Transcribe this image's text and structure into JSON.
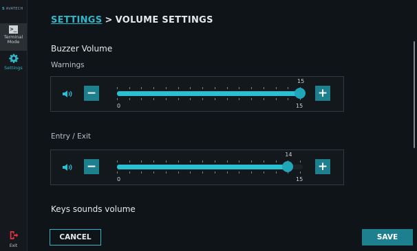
{
  "sidebar": {
    "brand": "AVATECH",
    "items": [
      {
        "label": "Terminal Mode",
        "icon": "terminal-icon"
      },
      {
        "label": "Settings",
        "icon": "gear-icon"
      }
    ],
    "exit_label": "Exit",
    "accent": "#2fb7c9"
  },
  "header": {
    "breadcrumb_link": "SETTINGS",
    "separator": ">",
    "title": "VOLUME SETTINGS"
  },
  "buzzer": {
    "title": "Buzzer Volume",
    "sliders": [
      {
        "label": "Warnings",
        "value": 15,
        "min": 0,
        "max": 15,
        "value_label": "15",
        "min_label": "0",
        "max_label": "15"
      },
      {
        "label": "Entry / Exit",
        "value": 14,
        "min": 0,
        "max": 15,
        "value_label": "14",
        "min_label": "0",
        "max_label": "15"
      }
    ]
  },
  "keys": {
    "title": "Keys sounds volume"
  },
  "actions": {
    "cancel_label": "CANCEL",
    "save_label": "SAVE"
  }
}
